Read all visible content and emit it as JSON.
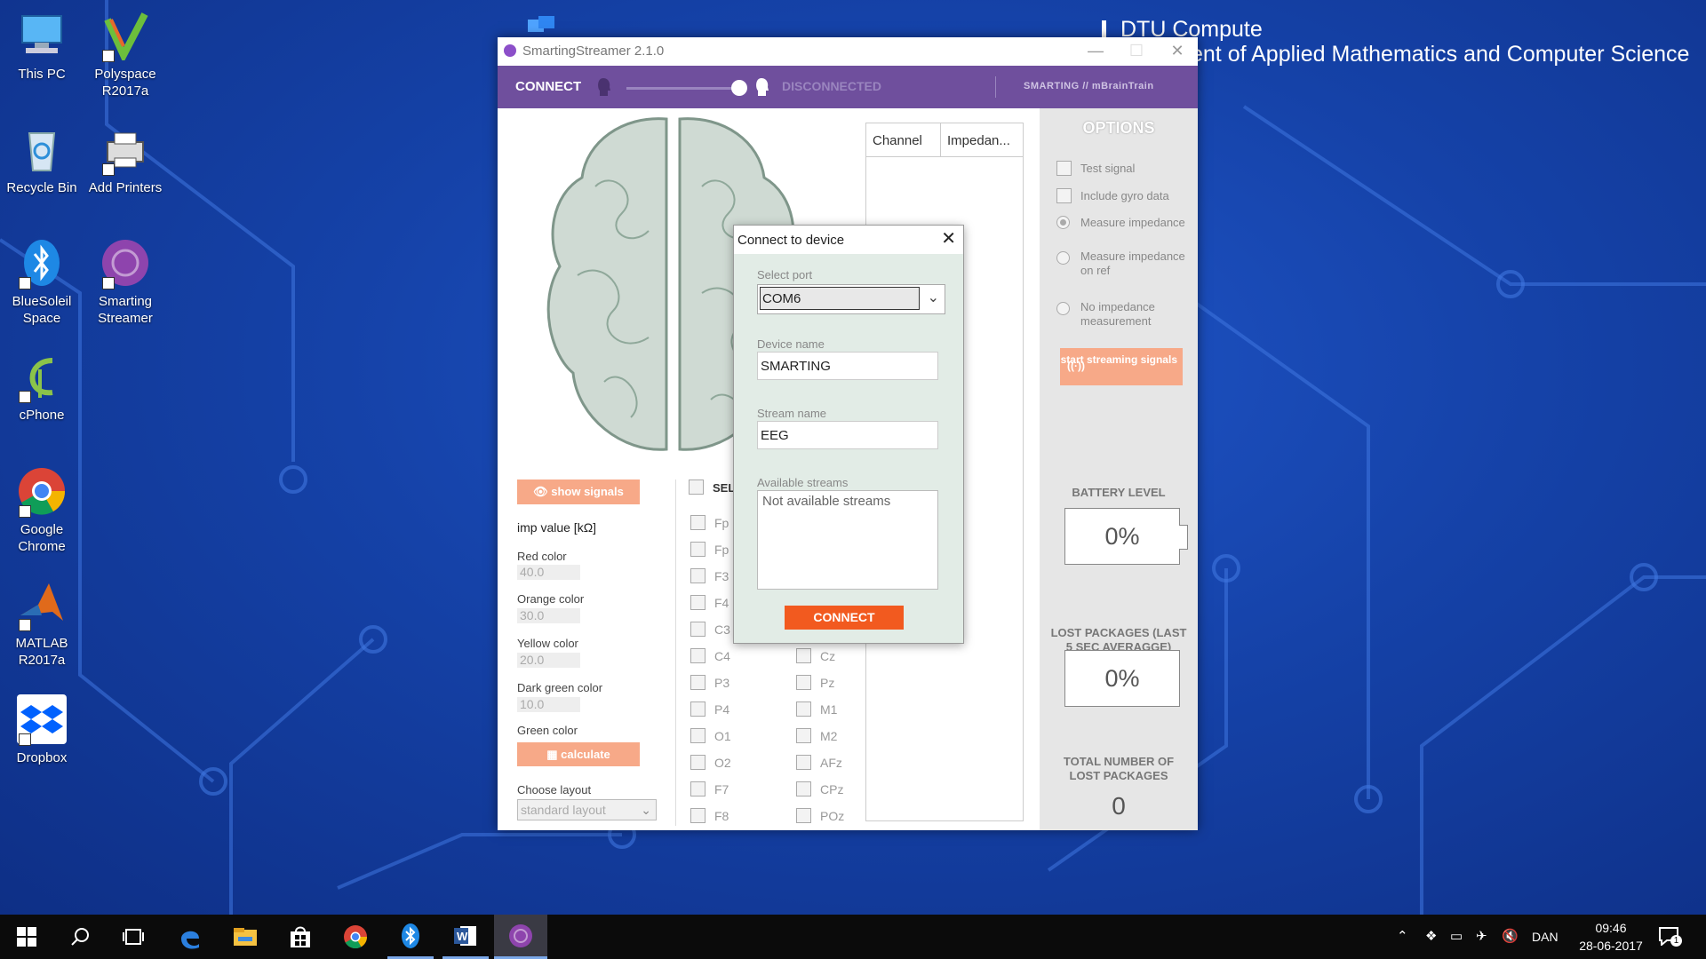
{
  "desktop": {
    "brand_line1": "DTU Compute",
    "brand_line2": "ent of Applied Mathematics and Computer Science",
    "icons": [
      {
        "label": "This PC"
      },
      {
        "label": "Polyspace R2017a"
      },
      {
        "label": "Recycle Bin"
      },
      {
        "label": "Add Printers"
      },
      {
        "label": "BlueSoleil Space"
      },
      {
        "label": "Smarting Streamer"
      },
      {
        "label": "cPhone"
      },
      {
        "label": "Google Chrome"
      },
      {
        "label": "MATLAB R2017a"
      },
      {
        "label": "Dropbox"
      }
    ]
  },
  "window": {
    "title": "SmartingStreamer 2.1.0",
    "topbar": {
      "connect": "CONNECT",
      "status": "DISCONNECTED",
      "brand": "SMARTING // mBrainTrain"
    },
    "left": {
      "show_signals": "show signals",
      "imp_value": "imp value [kΩ]",
      "red_label": "Red color",
      "red_value": "40.0",
      "orange_label": "Orange color",
      "orange_value": "30.0",
      "yellow_label": "Yellow color",
      "yellow_value": "20.0",
      "dgreen_label": "Dark green color",
      "dgreen_value": "10.0",
      "green_label": "Green color",
      "calculate": "calculate",
      "layout_label": "Choose layout",
      "layout_value": "standard layout"
    },
    "channels": {
      "select_all": "SEL",
      "col1": [
        "Fp",
        "Fp",
        "F3",
        "F4",
        "C3",
        "C4",
        "P3",
        "P4",
        "O1",
        "O2",
        "F7",
        "F8"
      ],
      "col2": [
        "Cz",
        "Pz",
        "M1",
        "M2",
        "AFz",
        "CPz",
        "POz"
      ]
    },
    "table": {
      "col1": "Channel",
      "col2": "Impedan..."
    },
    "options": {
      "title": "OPTIONS",
      "test_signal": "Test signal",
      "gyro": "Include gyro data",
      "measure_imp": "Measure impedance",
      "measure_ref": "Measure impedance on ref",
      "no_imp": "No impedance measurement",
      "start_stream": "start streaming signals",
      "battery_label": "BATTERY LEVEL",
      "battery_value": "0%",
      "lost_label": "LOST PACKAGES (LAST 5 SEC AVERAGGE)",
      "lost_value": "0%",
      "total_label": "TOTAL NUMBER OF LOST PACKAGES",
      "total_value": "0"
    }
  },
  "dialog": {
    "title": "Connect to device",
    "port_label": "Select port",
    "port_value": "COM6",
    "device_label": "Device name",
    "device_value": "SMARTING",
    "stream_label": "Stream name",
    "stream_value": "EEG",
    "avail_label": "Available streams",
    "avail_value": "Not available streams",
    "connect": "CONNECT"
  },
  "taskbar": {
    "lang": "DAN",
    "time": "09:46",
    "date": "28-06-2017",
    "notif_count": "1"
  }
}
